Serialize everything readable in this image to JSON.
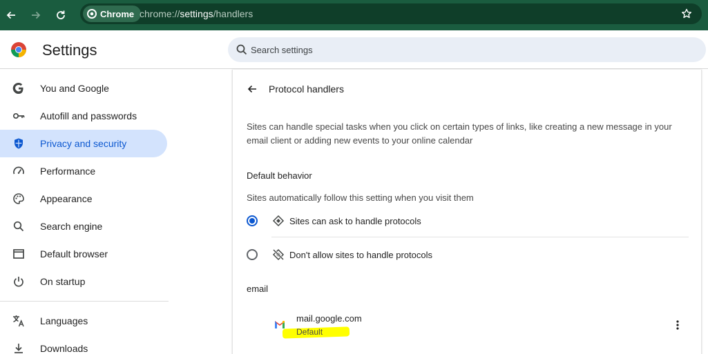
{
  "toolbar": {
    "site_chip_label": "Chrome",
    "url_scheme": "chrome://",
    "url_path": "settings",
    "url_rest": "/handlers"
  },
  "header": {
    "title": "Settings",
    "search_placeholder": "Search settings"
  },
  "sidebar": {
    "items": [
      {
        "label": "You and Google",
        "icon": "google-g-icon"
      },
      {
        "label": "Autofill and passwords",
        "icon": "key-icon"
      },
      {
        "label": "Privacy and security",
        "icon": "shield-icon",
        "active": true
      },
      {
        "label": "Performance",
        "icon": "speedometer-icon"
      },
      {
        "label": "Appearance",
        "icon": "palette-icon"
      },
      {
        "label": "Search engine",
        "icon": "search-icon"
      },
      {
        "label": "Default browser",
        "icon": "browser-window-icon"
      },
      {
        "label": "On startup",
        "icon": "power-icon"
      },
      {
        "label": "Languages",
        "icon": "translate-icon"
      },
      {
        "label": "Downloads",
        "icon": "download-icon"
      }
    ]
  },
  "main": {
    "title": "Protocol handlers",
    "description": "Sites can handle special tasks when you click on certain types of links, like creating a new message in your email client or adding new events to your online calendar",
    "default_behavior": {
      "heading": "Default behavior",
      "subheading": "Sites automatically follow this setting when you visit them",
      "options": [
        {
          "label": "Sites can ask to handle protocols",
          "checked": true
        },
        {
          "label": "Don't allow sites to handle protocols",
          "checked": false
        }
      ]
    },
    "email_section": {
      "heading": "email",
      "handler_site": "mail.google.com",
      "handler_status": "Default"
    }
  },
  "colors": {
    "toolbar": "#1a5c3f",
    "accent": "#0b57d0",
    "active_nav_bg": "#d3e3fd",
    "highlight": "#ffff00"
  }
}
